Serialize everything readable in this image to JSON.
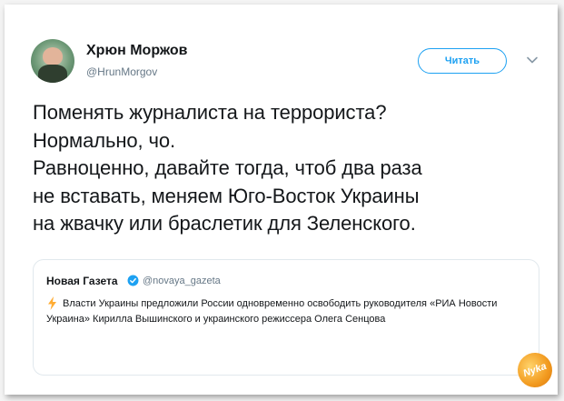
{
  "tweet": {
    "display_name": "Хрюн Моржов",
    "handle": "@HrunMorgov",
    "follow_label": "Читать",
    "text": "Поменять журналиста на террориста?\nНормально, чо.\nРавноценно, давайте тогда, чтоб два раза\nне вставать, меняем Юго-Восток Украины\nна жвачку или браслетик для Зеленского."
  },
  "quote": {
    "display_name": "Новая Газета",
    "handle": "@novaya_gazeta",
    "text": "Власти Украины предложили России одновременно освободить руководителя «РИА Новости Украина» Кирилла Вышинского и украинского режиссера Олега Сенцова"
  },
  "watermark": {
    "text": "Nyka"
  },
  "icons": {
    "avatar": "avatar",
    "chevron": "chevron-down-icon",
    "verified": "verified-icon",
    "bolt": "lightning-icon"
  },
  "colors": {
    "accent": "#1da1f2",
    "text": "#14171a",
    "muted": "#657786",
    "bolt": "#ffac33"
  }
}
